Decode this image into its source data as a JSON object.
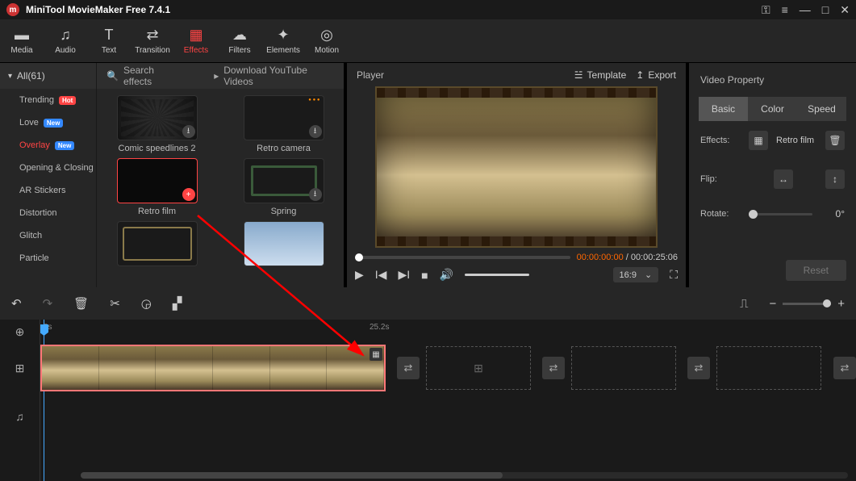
{
  "app": {
    "title": "MiniTool MovieMaker Free 7.4.1"
  },
  "toolbar": {
    "media": "Media",
    "audio": "Audio",
    "text": "Text",
    "transition": "Transition",
    "effects": "Effects",
    "filters": "Filters",
    "elements": "Elements",
    "motion": "Motion"
  },
  "categories": {
    "all": "All(61)",
    "items": [
      {
        "label": "Trending",
        "badge": "Hot",
        "badgeClass": "hot"
      },
      {
        "label": "Love",
        "badge": "New",
        "badgeClass": "new"
      },
      {
        "label": "Overlay",
        "badge": "New",
        "badgeClass": "new",
        "active": true
      },
      {
        "label": "Opening & Closing"
      },
      {
        "label": "AR Stickers"
      },
      {
        "label": "Distortion"
      },
      {
        "label": "Glitch"
      },
      {
        "label": "Particle"
      }
    ]
  },
  "search": {
    "placeholder": "Search effects",
    "download": "Download YouTube Videos"
  },
  "effects": {
    "items": [
      {
        "label": "Comic speedlines 2"
      },
      {
        "label": "Retro camera"
      },
      {
        "label": "Retro film",
        "selected": true
      },
      {
        "label": "Spring"
      },
      {
        "label": ""
      },
      {
        "label": ""
      }
    ]
  },
  "player": {
    "title": "Player",
    "template": "Template",
    "export": "Export",
    "current": "00:00:00:00",
    "total": "00:00:25:06",
    "ratio": "16:9"
  },
  "property": {
    "title": "Video Property",
    "tabs": {
      "basic": "Basic",
      "color": "Color",
      "speed": "Speed"
    },
    "effects_label": "Effects:",
    "effect_name": "Retro film",
    "flip_label": "Flip:",
    "rotate_label": "Rotate:",
    "rotate_value": "0°",
    "reset": "Reset"
  },
  "timeline": {
    "ruler": {
      "t0": "0s",
      "t1": "25.2s"
    }
  }
}
